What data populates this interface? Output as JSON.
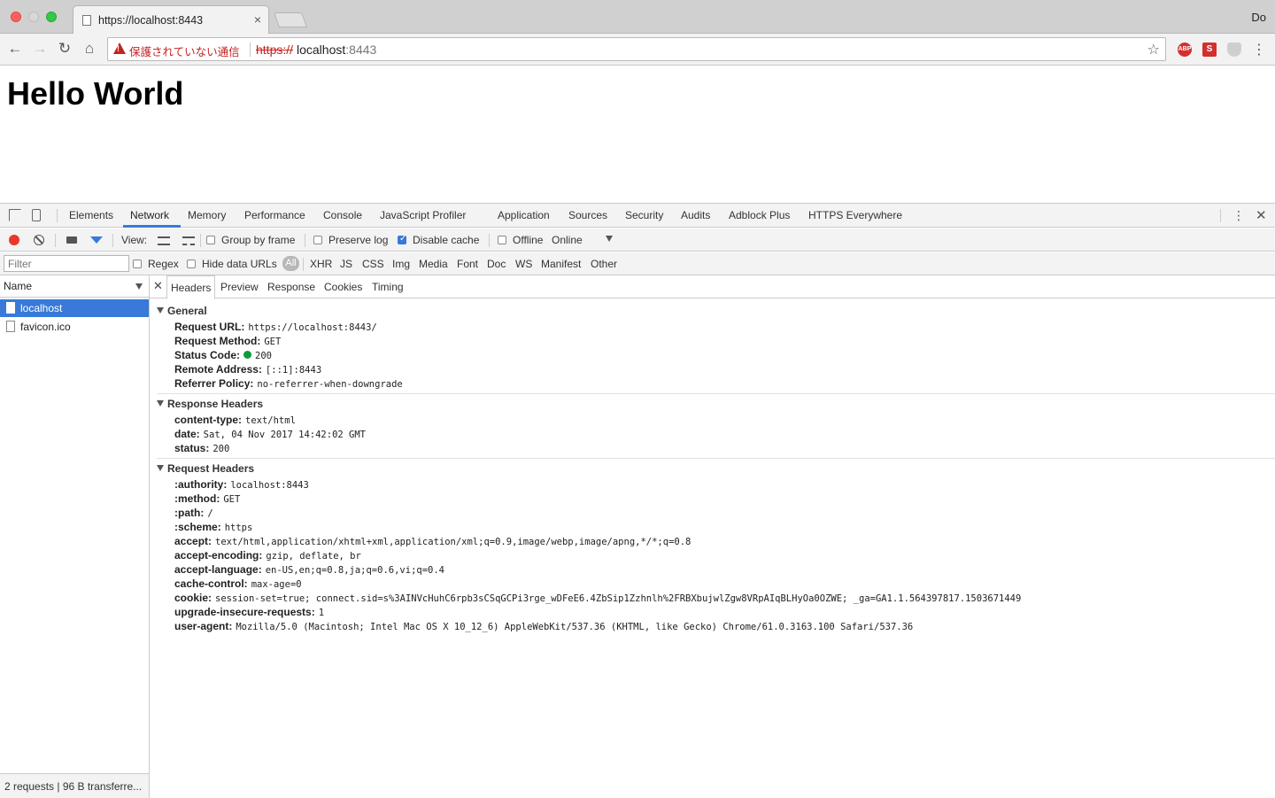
{
  "browser": {
    "tab_title": "https://localhost:8443",
    "tab_close": "×",
    "user_label": "Do",
    "security_warning": "保護されていない通信",
    "url_scheme": "https://",
    "url_host": "localhost",
    "url_port": ":8443",
    "ext_abp": "ABP",
    "ext_s": "S"
  },
  "page": {
    "heading": "Hello World"
  },
  "devtools": {
    "tabs": [
      "Elements",
      "Network",
      "Memory",
      "Performance",
      "Console",
      "JavaScript Profiler",
      "Application",
      "Sources",
      "Security",
      "Audits",
      "Adblock Plus",
      "HTTPS Everywhere"
    ],
    "active_tab": "Network",
    "toolbar": {
      "view_label": "View:",
      "group_by_frame": "Group by frame",
      "preserve_log": "Preserve log",
      "disable_cache": "Disable cache",
      "offline": "Offline",
      "throttle": "Online"
    },
    "filter_bar": {
      "filter_placeholder": "Filter",
      "regex": "Regex",
      "hide_data_urls": "Hide data URLs",
      "types": [
        "All",
        "XHR",
        "JS",
        "CSS",
        "Img",
        "Media",
        "Font",
        "Doc",
        "WS",
        "Manifest",
        "Other"
      ]
    },
    "requests": {
      "column": "Name",
      "items": [
        "localhost",
        "favicon.ico"
      ],
      "footer": "2 requests | 96 B transferre..."
    },
    "detail_tabs": [
      "Headers",
      "Preview",
      "Response",
      "Cookies",
      "Timing"
    ],
    "general": {
      "title": "General",
      "rows": [
        {
          "k": "Request URL:",
          "v": "https://localhost:8443/"
        },
        {
          "k": "Request Method:",
          "v": "GET"
        },
        {
          "k": "Status Code:",
          "v": "200"
        },
        {
          "k": "Remote Address:",
          "v": "[::1]:8443"
        },
        {
          "k": "Referrer Policy:",
          "v": "no-referrer-when-downgrade"
        }
      ]
    },
    "response_headers": {
      "title": "Response Headers",
      "rows": [
        {
          "k": "content-type:",
          "v": "text/html"
        },
        {
          "k": "date:",
          "v": "Sat, 04 Nov 2017 14:42:02 GMT"
        },
        {
          "k": "status:",
          "v": "200"
        }
      ]
    },
    "request_headers": {
      "title": "Request Headers",
      "rows": [
        {
          "k": ":authority:",
          "v": "localhost:8443"
        },
        {
          "k": ":method:",
          "v": "GET"
        },
        {
          "k": ":path:",
          "v": "/"
        },
        {
          "k": ":scheme:",
          "v": "https"
        },
        {
          "k": "accept:",
          "v": "text/html,application/xhtml+xml,application/xml;q=0.9,image/webp,image/apng,*/*;q=0.8"
        },
        {
          "k": "accept-encoding:",
          "v": "gzip, deflate, br"
        },
        {
          "k": "accept-language:",
          "v": "en-US,en;q=0.8,ja;q=0.6,vi;q=0.4"
        },
        {
          "k": "cache-control:",
          "v": "max-age=0"
        },
        {
          "k": "cookie:",
          "v": "session-set=true; connect.sid=s%3AINVcHuhC6rpb3sCSqGCPi3rge_wDFeE6.4ZbSip1Zzhnlh%2FRBXbujwlZgw8VRpAIqBLHyOa0OZWE; _ga=GA1.1.564397817.1503671449"
        },
        {
          "k": "upgrade-insecure-requests:",
          "v": "1"
        },
        {
          "k": "user-agent:",
          "v": "Mozilla/5.0 (Macintosh; Intel Mac OS X 10_12_6) AppleWebKit/537.36 (KHTML, like Gecko) Chrome/61.0.3163.100 Safari/537.36"
        }
      ]
    }
  }
}
